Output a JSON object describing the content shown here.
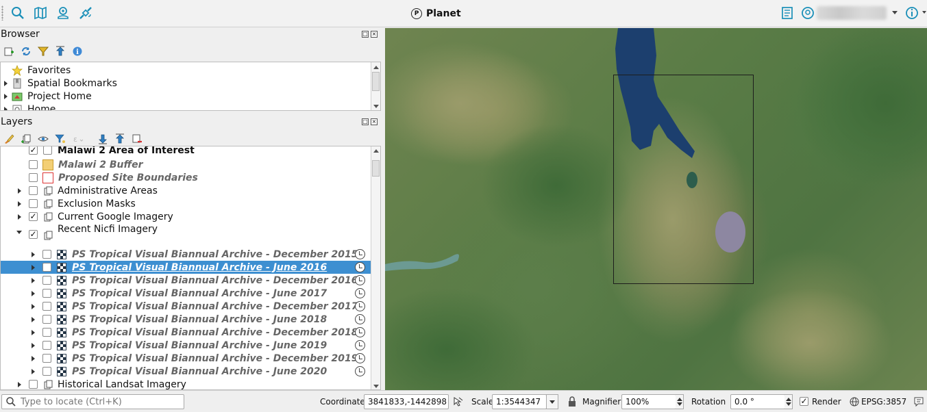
{
  "app": {
    "title": "Planet"
  },
  "colors": {
    "selection": "#3d8fd1",
    "accent_blue": "#1a8fb8",
    "map_water": "#1c3f6e"
  },
  "browser": {
    "title": "Browser",
    "toolbar_icons": [
      "add-layer-icon",
      "refresh-icon",
      "filter-icon",
      "collapse-all-icon",
      "info-icon"
    ],
    "items": [
      {
        "label": "Favorites",
        "icon": "star-icon",
        "expandable": false
      },
      {
        "label": "Spatial Bookmarks",
        "icon": "bookmark-icon",
        "expandable": true
      },
      {
        "label": "Project Home",
        "icon": "project-home-icon",
        "expandable": true
      },
      {
        "label": "Home",
        "icon": "home-icon",
        "expandable": true
      }
    ]
  },
  "layers": {
    "title": "Layers",
    "items": [
      {
        "label": "Malawi 2 Area of Interest",
        "checked": true,
        "style": "bold"
      },
      {
        "label": "Malawi 2 Buffer",
        "checked": false,
        "style": "italic"
      },
      {
        "label": "Proposed Site Boundaries",
        "checked": false,
        "style": "italic"
      },
      {
        "label": "Administrative Areas",
        "checked": false,
        "group": true
      },
      {
        "label": "Exclusion Masks",
        "checked": false,
        "group": true
      },
      {
        "label": "Current Google Imagery",
        "checked": true,
        "group": true
      },
      {
        "label": "Recent Nicfi Imagery",
        "checked": true,
        "group": true,
        "expanded": true
      },
      {
        "label": "PS Tropical Visual Biannual Archive - December 2015",
        "checked": false
      },
      {
        "label": "PS Tropical Visual Biannual Archive - June 2016",
        "checked": false,
        "selected": true
      },
      {
        "label": "PS Tropical Visual Biannual Archive - December 2016",
        "checked": false
      },
      {
        "label": "PS Tropical Visual Biannual Archive - June 2017",
        "checked": false
      },
      {
        "label": "PS Tropical Visual Biannual Archive - December 2017",
        "checked": false
      },
      {
        "label": "PS Tropical Visual Biannual Archive - June 2018",
        "checked": false
      },
      {
        "label": "PS Tropical Visual Biannual Archive - December 2018",
        "checked": false
      },
      {
        "label": "PS Tropical Visual Biannual Archive - June 2019",
        "checked": false
      },
      {
        "label": "PS Tropical Visual Biannual Archive - December 2019",
        "checked": false
      },
      {
        "label": "PS Tropical Visual Biannual Archive - June 2020",
        "checked": false
      },
      {
        "label": "Historical Landsat Imagery",
        "checked": false,
        "group": true
      }
    ]
  },
  "statusbar": {
    "locate_placeholder": "Type to locate (Ctrl+K)",
    "coordinate_label": "Coordinate",
    "coordinate_value": "3841833,-1442898",
    "scale_label": "Scale",
    "scale_value": "1:3544347",
    "magnifier_label": "Magnifier",
    "magnifier_value": "100%",
    "rotation_label": "Rotation",
    "rotation_value": "0.0 °",
    "render_label": "Render",
    "render_checked": true,
    "crs": "EPSG:3857"
  }
}
